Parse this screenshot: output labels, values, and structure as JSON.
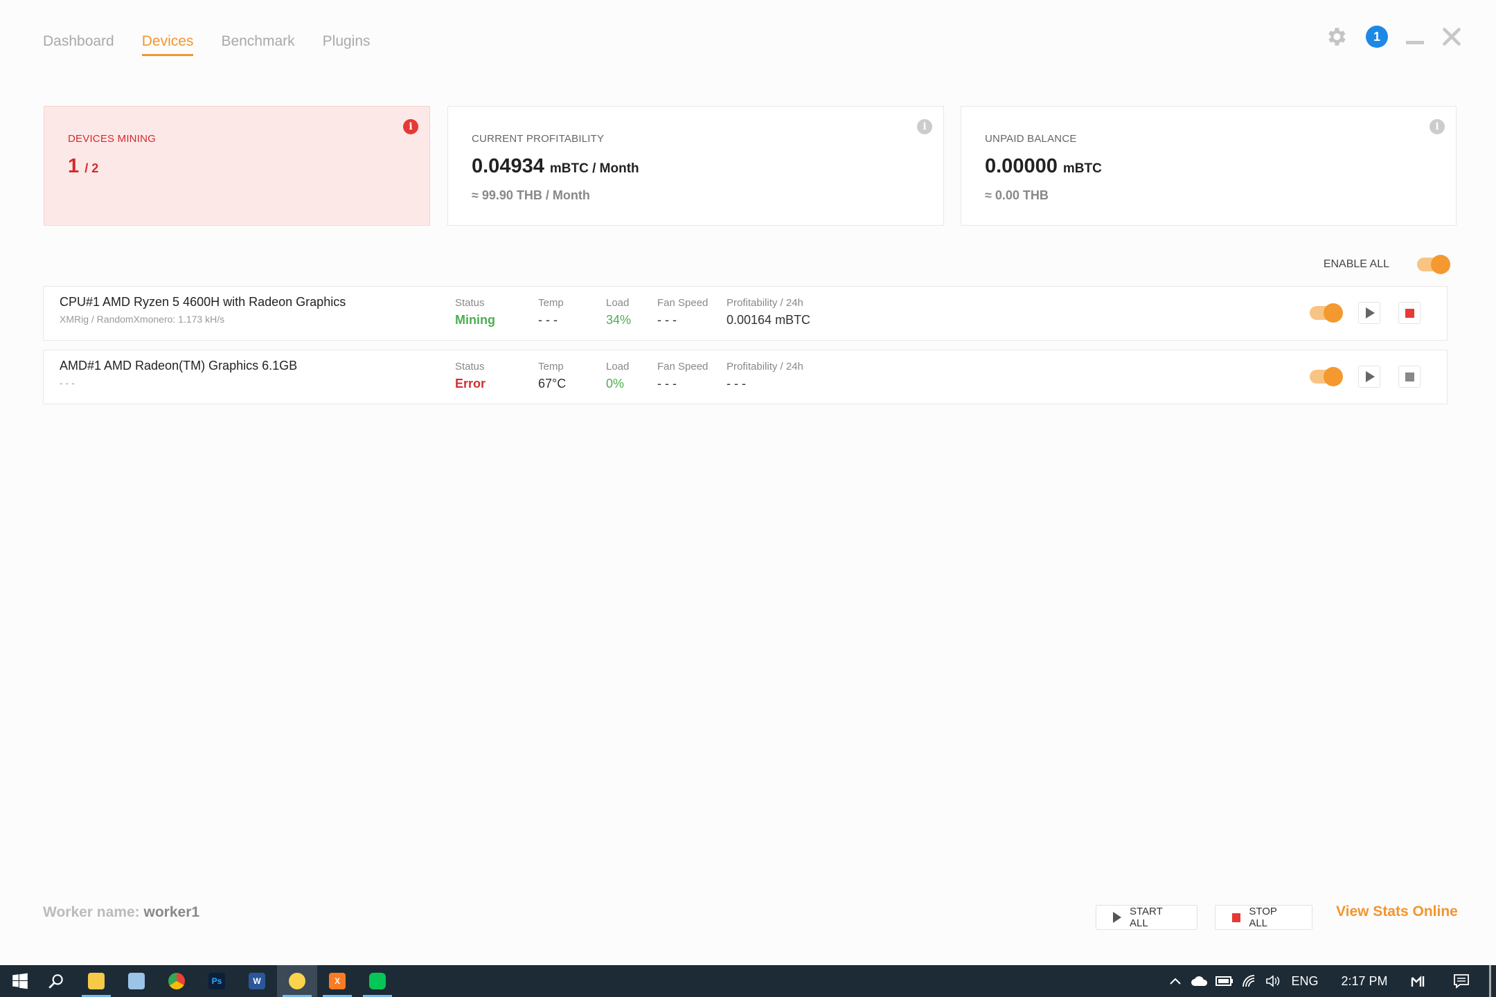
{
  "nav": {
    "tabs": [
      {
        "label": "Dashboard",
        "active": false
      },
      {
        "label": "Devices",
        "active": true
      },
      {
        "label": "Benchmark",
        "active": false
      },
      {
        "label": "Plugins",
        "active": false
      }
    ]
  },
  "window": {
    "notification_count": "1"
  },
  "cards": {
    "devices_mining": {
      "label": "DEVICES MINING",
      "value": "1",
      "total": "/ 2",
      "color": "#d42a2a"
    },
    "profitability": {
      "label": "CURRENT PROFITABILITY",
      "value": "0.04934",
      "unit": "mBTC / Month",
      "sub": "≈ 99.90 THB / Month"
    },
    "balance": {
      "label": "UNPAID BALANCE",
      "value": "0.00000",
      "unit": "mBTC",
      "sub": "≈ 0.00 THB"
    }
  },
  "enable_all": {
    "label": "ENABLE ALL",
    "on": true
  },
  "columns": {
    "status": "Status",
    "temp": "Temp",
    "load": "Load",
    "fan": "Fan Speed",
    "profit": "Profitability / 24h"
  },
  "devices": [
    {
      "name": "CPU#1 AMD Ryzen 5 4600H with Radeon Graphics",
      "sub": "XMRig / RandomXmonero: 1.173 kH/s",
      "status": "Mining",
      "temp": "- - -",
      "load": "34%",
      "fan": "- - -",
      "profit": "0.00164 mBTC",
      "enabled": true
    },
    {
      "name": "AMD#1 AMD Radeon(TM) Graphics 6.1GB",
      "sub": "- - -",
      "status": "Error",
      "temp": "67°C",
      "load": "0%",
      "fan": "- - -",
      "profit": "- - -",
      "enabled": true
    }
  ],
  "footer": {
    "worker_label": "Worker name:",
    "worker_value": "worker1",
    "start_all": "START ALL",
    "stop_all": "STOP ALL",
    "view_stats": "View Stats Online"
  },
  "taskbar": {
    "apps": [
      "windows-start",
      "search",
      "file-explorer",
      "notepad",
      "chrome",
      "photoshop",
      "word",
      "nicehash",
      "xampp",
      "line"
    ],
    "language": "ENG",
    "time": "2:17 PM"
  },
  "colors": {
    "accent": "#f3952e",
    "error": "#d32f2f",
    "success": "#4caf50",
    "info": "#1e88e5"
  }
}
